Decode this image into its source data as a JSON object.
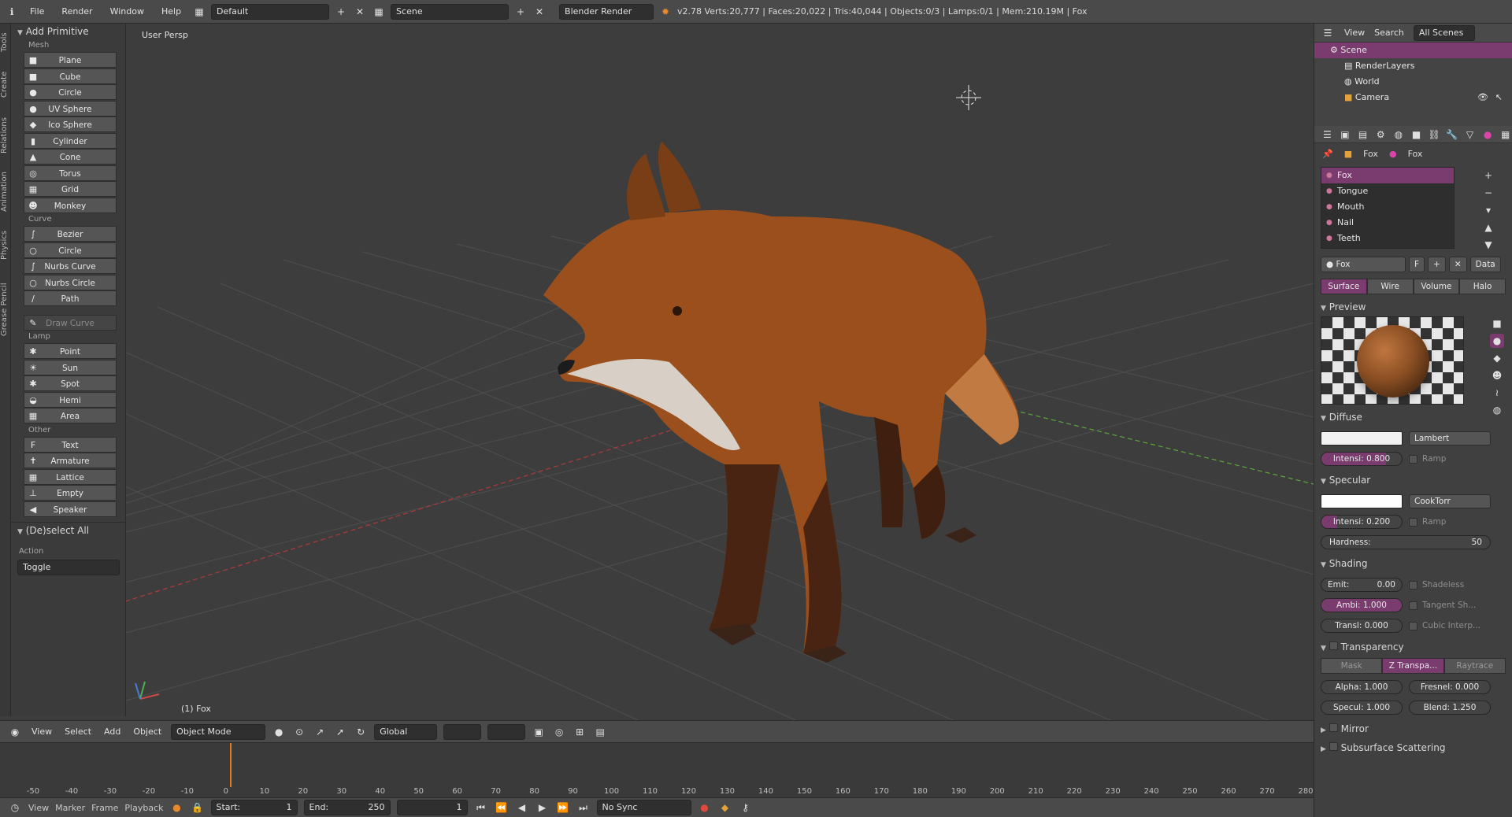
{
  "top": {
    "menus": [
      "File",
      "Render",
      "Window",
      "Help"
    ],
    "layout": "Default",
    "scene": "Scene",
    "engine": "Blender Render",
    "stats": "v2.78   Verts:20,777 | Faces:20,022 | Tris:40,044 | Objects:0/3 | Lamps:0/1 | Mem:210.19M | Fox"
  },
  "lefttabs": [
    "Tools",
    "Create",
    "Relations",
    "Animation",
    "Physics",
    "Grease Pencil"
  ],
  "toolshelf": {
    "panel": "Add Primitive",
    "groups": [
      {
        "label": "Mesh",
        "items": [
          {
            "name": "Plane",
            "icon": "plane-icon",
            "glyph": "■"
          },
          {
            "name": "Cube",
            "icon": "cube-icon",
            "glyph": "■"
          },
          {
            "name": "Circle",
            "icon": "circle-icon",
            "glyph": "●"
          },
          {
            "name": "UV Sphere",
            "icon": "uv-sphere-icon",
            "glyph": "●"
          },
          {
            "name": "Ico Sphere",
            "icon": "ico-sphere-icon",
            "glyph": "◆"
          },
          {
            "name": "Cylinder",
            "icon": "cylinder-icon",
            "glyph": "▮"
          },
          {
            "name": "Cone",
            "icon": "cone-icon",
            "glyph": "▲"
          },
          {
            "name": "Torus",
            "icon": "torus-icon",
            "glyph": "◎"
          },
          {
            "name": "Grid",
            "icon": "grid-icon",
            "glyph": "▦"
          },
          {
            "name": "Monkey",
            "icon": "monkey-icon",
            "glyph": "☻"
          }
        ]
      },
      {
        "label": "Curve",
        "items": [
          {
            "name": "Bezier",
            "icon": "bezier-icon",
            "glyph": "∫"
          },
          {
            "name": "Circle",
            "icon": "curve-circle-icon",
            "glyph": "○"
          },
          {
            "name": "Nurbs Curve",
            "icon": "nurbs-curve-icon",
            "glyph": "∫"
          },
          {
            "name": "Nurbs Circle",
            "icon": "nurbs-circle-icon",
            "glyph": "○"
          },
          {
            "name": "Path",
            "icon": "path-icon",
            "glyph": "∕"
          }
        ]
      },
      {
        "label": "",
        "items": [
          {
            "name": "Draw Curve",
            "icon": "draw-curve-icon",
            "glyph": "✎",
            "disabled": true
          }
        ]
      },
      {
        "label": "Lamp",
        "items": [
          {
            "name": "Point",
            "icon": "point-lamp-icon",
            "glyph": "✱"
          },
          {
            "name": "Sun",
            "icon": "sun-icon",
            "glyph": "☀"
          },
          {
            "name": "Spot",
            "icon": "spot-icon",
            "glyph": "✱"
          },
          {
            "name": "Hemi",
            "icon": "hemi-icon",
            "glyph": "◒"
          },
          {
            "name": "Area",
            "icon": "area-icon",
            "glyph": "▦"
          }
        ]
      },
      {
        "label": "Other",
        "items": [
          {
            "name": "Text",
            "icon": "text-icon",
            "glyph": "F"
          },
          {
            "name": "Armature",
            "icon": "armature-icon",
            "glyph": "✝"
          },
          {
            "name": "Lattice",
            "icon": "lattice-icon",
            "glyph": "▦"
          },
          {
            "name": "Empty",
            "icon": "empty-icon",
            "glyph": "⊥"
          },
          {
            "name": "Speaker",
            "icon": "speaker-icon",
            "glyph": "◀"
          }
        ]
      }
    ],
    "operator": "(De)select All",
    "action_label": "Action",
    "action_value": "Toggle"
  },
  "viewport": {
    "label": "User Persp",
    "object": "(1) Fox"
  },
  "vpheader": {
    "menus": [
      "View",
      "Select",
      "Add",
      "Object"
    ],
    "mode": "Object Mode",
    "orientation": "Global"
  },
  "timeline": {
    "ticks": [
      -50,
      -40,
      -30,
      -20,
      -10,
      0,
      10,
      20,
      30,
      40,
      50,
      60,
      70,
      80,
      90,
      100,
      110,
      120,
      130,
      140,
      150,
      160,
      170,
      180,
      190,
      200,
      210,
      220,
      230,
      240,
      250,
      260,
      270,
      280
    ],
    "playhead_frame": 1
  },
  "tlheader": {
    "menus": [
      "View",
      "Marker",
      "Frame",
      "Playback"
    ],
    "start_label": "Start:",
    "start_value": "1",
    "end_label": "End:",
    "end_value": "250",
    "current": "1",
    "sync": "No Sync"
  },
  "outliner": {
    "menus": [
      "View",
      "Search",
      "All Scenes"
    ],
    "rows": [
      "Scene",
      "RenderLayers",
      "World",
      "Camera"
    ]
  },
  "properties": {
    "context": [
      "Fox",
      "Fox"
    ],
    "slots": [
      "Fox",
      "Tongue",
      "Mouth",
      "Nail",
      "Teeth"
    ],
    "material": "Fox",
    "link": "Data",
    "tabs": [
      "Surface",
      "Wire",
      "Volume",
      "Halo"
    ],
    "preview_label": "Preview",
    "diffuse": {
      "label": "Diffuse",
      "shader": "Lambert",
      "intensity": "Intensi: 0.800",
      "intensity_value": 0.8,
      "ramp": "Ramp",
      "color": "#f2f2f2"
    },
    "specular": {
      "label": "Specular",
      "shader": "CookTorr",
      "intensity": "Intensi: 0.200",
      "intensity_value": 0.2,
      "ramp": "Ramp",
      "hardness": "Hardness:",
      "hardness_value": "50",
      "color": "#ffffff"
    },
    "shading": {
      "label": "Shading",
      "emit": "Emit:",
      "emit_value": "0.00",
      "ambient": "Ambi: 1.000",
      "ambient_value": 1.0,
      "translucency": "Transl: 0.000",
      "translucency_value": 0.0,
      "shadeless": "Shadeless",
      "tangent": "Tangent Sh...",
      "cubic": "Cubic Interp..."
    },
    "transparency": {
      "label": "Transparency",
      "modes": [
        "Mask",
        "Z Transpa...",
        "Raytrace"
      ],
      "alpha": "Alpha: 1.000",
      "fresnel": "Fresnel: 0.000",
      "specular": "Specul: 1.000",
      "blend": "Blend: 1.250"
    },
    "mirror": "Mirror",
    "sss": "Subsurface Scattering"
  },
  "colors": {
    "accent": "#7a3b6f",
    "playhead": "#e07a1d",
    "grid": "#505050",
    "axis_x": "#b03a3a",
    "axis_y": "#5aa83a"
  }
}
